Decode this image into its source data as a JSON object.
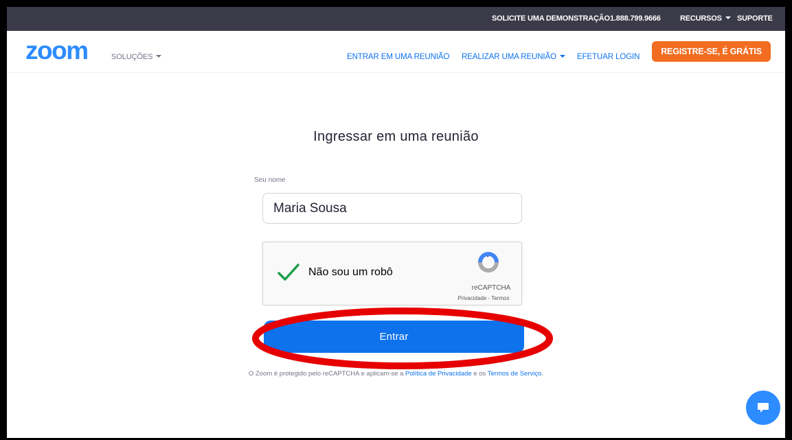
{
  "topbar": {
    "demo": "SOLICITE UMA DEMONSTRAÇÃO",
    "phone": "1.888.799.9666",
    "resources": "RECURSOS",
    "support": "SUPORTE"
  },
  "nav": {
    "logo": "zoom",
    "solutions": "SOLUÇÕES",
    "join": "ENTRAR EM UMA REUNIÃO",
    "host": "REALIZAR UMA REUNIÃO",
    "login": "EFETUAR LOGIN",
    "register": "REGISTRE-SE, É GRÁTIS"
  },
  "form": {
    "title": "Ingressar em uma reunião",
    "name_label": "Seu nome",
    "name_value": "Maria Sousa"
  },
  "captcha": {
    "label": "Não sou um robô",
    "brand": "reCAPTCHA",
    "privacy": "Privacidade",
    "separator": " - ",
    "terms": "Termos",
    "checked": true
  },
  "submit_label": "Entrar",
  "footnote": {
    "prefix": "O Zoom é protegido pelo reCAPTCHA e aplicam-se a ",
    "privacy_link": "Política de Privacidade",
    "middle": " e os ",
    "terms_link": "Termos de Serviço",
    "suffix": "."
  },
  "icons": {
    "chat": "chat-bubble-icon",
    "check": "checkmark-icon",
    "recaptcha": "recaptcha-logo-icon"
  },
  "colors": {
    "brand_blue": "#2d8cff",
    "link_blue": "#0e72ed",
    "orange": "#f26d21",
    "topbar": "#3b3a48",
    "annotation_red": "#e60000",
    "check_green": "#1e9e4a"
  }
}
